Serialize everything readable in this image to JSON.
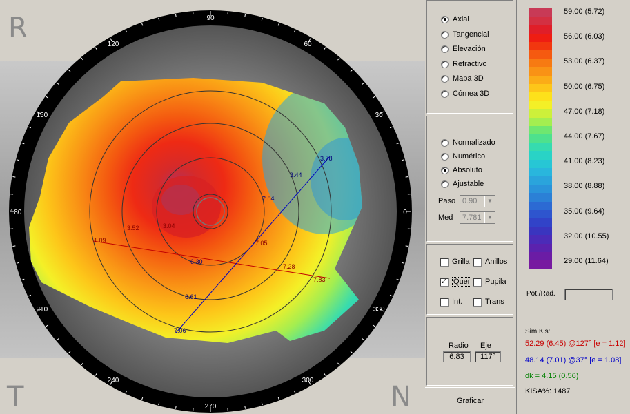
{
  "corners": {
    "top_left": "R",
    "bottom_left": "T",
    "bottom_right": "N"
  },
  "angle_labels": [
    "0",
    "30",
    "60",
    "90",
    "120",
    "150",
    "180",
    "210",
    "240",
    "270",
    "300",
    "330"
  ],
  "red_axis_values": [
    "1.09",
    "3.52",
    "3.04",
    "7.05",
    "7.28",
    "7.83"
  ],
  "blue_axis_values": [
    "2.84",
    "3.44",
    "3.78",
    "6.30",
    "6.61",
    "7.06"
  ],
  "map_type": {
    "options": [
      "Axial",
      "Tangencial",
      "Elevación",
      "Refractivo",
      "Mapa 3D",
      "Córnea 3D"
    ],
    "selected": "Axial"
  },
  "scale": {
    "options": [
      "Normalizado",
      "Numérico",
      "Absoluto",
      "Ajustable"
    ],
    "selected": "Absoluto",
    "paso_label": "Paso",
    "paso_value": "0.90",
    "med_label": "Med",
    "med_value": "7.781"
  },
  "overlays": {
    "grilla": {
      "label": "Grilla",
      "checked": false
    },
    "anillos": {
      "label": "Anillos",
      "checked": false
    },
    "quer": {
      "label": "Quer",
      "checked": true
    },
    "pupila": {
      "label": "Pupila",
      "checked": false
    },
    "int": {
      "label": "Int.",
      "checked": false
    },
    "trans": {
      "label": "Trans",
      "checked": false
    }
  },
  "radio_eje": {
    "radio_label": "Radio",
    "radio_value": "6.83",
    "eje_label": "Eje",
    "eje_value": "117°"
  },
  "graficar_label": "Graficar",
  "legend": {
    "labels": [
      "59.00 (5.72)",
      "56.00 (6.03)",
      "53.00 (6.37)",
      "50.00 (6.75)",
      "47.00 (7.18)",
      "44.00 (7.67)",
      "41.00 (8.23)",
      "38.00 (8.88)",
      "35.00 (9.64)",
      "32.00 (10.55)",
      "29.00 (11.64)"
    ],
    "colors": [
      "#c83a56",
      "#d33042",
      "#e01e28",
      "#ef1d12",
      "#f2370f",
      "#f55a10",
      "#f77a12",
      "#f99215",
      "#fbac17",
      "#fdc619",
      "#fde11b",
      "#f4f027",
      "#cdf03a",
      "#a4ee50",
      "#6fe770",
      "#4ee18d",
      "#36dbaf",
      "#29d3c6",
      "#27c6d5",
      "#29b6dd",
      "#2aa4dc",
      "#2a93da",
      "#2b80d6",
      "#2c6ad3",
      "#2e55ce",
      "#3143c8",
      "#3a35bf",
      "#4b2bb8",
      "#5b22ae",
      "#6b1ca5",
      "#771aa0"
    ]
  },
  "pot_rad_label": "Pot./Rad.",
  "sim_k": {
    "title": "Sim K's:",
    "k1": "52.29 (6.45) @127° [e = 1.12]",
    "k2": "48.14 (7.01) @37° [e = 1.08]",
    "dk": "dk = 4.15 (0.56)",
    "kisa": "KISA%: 1487",
    "k1_color": "#c80000",
    "k2_color": "#0000c8",
    "dk_color": "#008000"
  }
}
